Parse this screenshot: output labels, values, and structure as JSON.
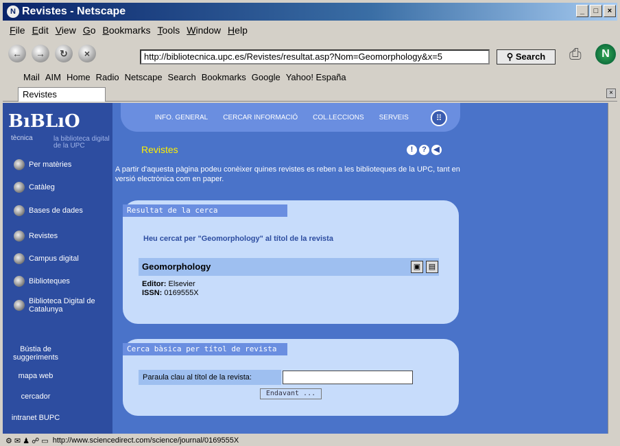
{
  "window": {
    "title": "Revistes - Netscape",
    "min": "_",
    "max": "□",
    "close": "×",
    "logo": "N"
  },
  "menu": [
    "File",
    "Edit",
    "View",
    "Go",
    "Bookmarks",
    "Tools",
    "Window",
    "Help"
  ],
  "nav": {
    "url": "http://bibliotecnica.upc.es/Revistes/resultat.asp?Nom=Geomorphology&x=5",
    "search_label": "Search"
  },
  "bookmarks": [
    "Mail",
    "AIM",
    "Home",
    "Radio",
    "Netscape",
    "Search",
    "Bookmarks",
    "Google",
    "Yahoo! España"
  ],
  "tab": {
    "label": "Revistes",
    "close": "×"
  },
  "status": {
    "text": "http://www.sciencedirect.com/science/journal/0169555X"
  },
  "site": {
    "logo": "BıBLıO",
    "logo_sub": "tècnica",
    "tagline": "la biblioteca digital de la UPC",
    "topnav": [
      "INFO. GENERAL",
      "CERCAR INFORMACIÓ",
      "COL.LECCIONS",
      "SERVEIS"
    ],
    "section_title": "Revistes",
    "menu": [
      "Per matèries",
      "Catàleg",
      "Bases de dades",
      "Revistes",
      "Campus digital",
      "Biblioteques",
      "Biblioteca Digital de Catalunya"
    ],
    "bottom_links": [
      "Bústia de suggeriments",
      "mapa web",
      "cercador",
      "intranet BUPC"
    ],
    "intro": "A partir d'aquesta pàgina podeu conèixer quines revistes es reben a les biblioteques de la UPC, tant en versió electrònica com en paper.",
    "result": {
      "panel_title": "Resultat de la cerca",
      "query_text": "Heu cercat per \"Geomorphology\" al títol de la revista",
      "journal": "Geomorphology",
      "editor_label": "Editor:",
      "editor": "Elsevier",
      "issn_label": "ISSN:",
      "issn": "0169555X"
    },
    "search": {
      "panel_title": "Cerca bàsica per títol de revista",
      "field_label": "Paraula clau al títol de la revista:",
      "field_value": "",
      "button": "Endavant ..."
    }
  }
}
